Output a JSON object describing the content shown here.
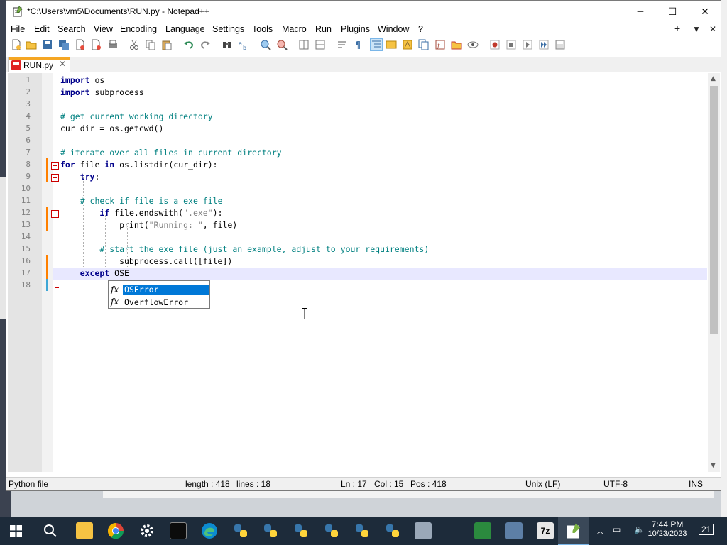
{
  "window": {
    "title": "*C:\\Users\\vm5\\Documents\\RUN.py - Notepad++",
    "minimize": "─",
    "maximize": "☐",
    "close": "✕"
  },
  "menu": {
    "items": [
      "File",
      "Edit",
      "Search",
      "View",
      "Encoding",
      "Language",
      "Settings",
      "Tools",
      "Macro",
      "Run",
      "Plugins",
      "Window",
      "?"
    ],
    "right_plus": "+",
    "right_down": "▼",
    "right_close": "✕"
  },
  "tab": {
    "label": "RUN.py",
    "close": "✕"
  },
  "editor": {
    "line_numbers": [
      "1",
      "2",
      "3",
      "4",
      "5",
      "6",
      "7",
      "8",
      "9",
      "10",
      "11",
      "12",
      "13",
      "14",
      "15",
      "16",
      "17",
      "18"
    ],
    "lines": [
      [
        {
          "t": "import",
          "c": "kw"
        },
        {
          "t": " os",
          "c": ""
        }
      ],
      [
        {
          "t": "import",
          "c": "kw"
        },
        {
          "t": " subprocess",
          "c": ""
        }
      ],
      [],
      [
        {
          "t": "# get current working directory",
          "c": "cm"
        }
      ],
      [
        {
          "t": "cur_dir = os.getcwd()",
          "c": ""
        }
      ],
      [],
      [
        {
          "t": "# iterate over all files in current directory",
          "c": "cm"
        }
      ],
      [
        {
          "t": "for",
          "c": "kw"
        },
        {
          "t": " file ",
          "c": ""
        },
        {
          "t": "in",
          "c": "kw"
        },
        {
          "t": " os.listdir(cur_dir):",
          "c": ""
        }
      ],
      [
        {
          "t": "    ",
          "c": ""
        },
        {
          "t": "try",
          "c": "kw"
        },
        {
          "t": ":",
          "c": ""
        }
      ],
      [],
      [
        {
          "t": "    ",
          "c": ""
        },
        {
          "t": "# check if file is a exe file",
          "c": "cm"
        }
      ],
      [
        {
          "t": "        ",
          "c": ""
        },
        {
          "t": "if",
          "c": "kw"
        },
        {
          "t": " file.endswith(",
          "c": ""
        },
        {
          "t": "\".exe\"",
          "c": "st"
        },
        {
          "t": "):",
          "c": ""
        }
      ],
      [
        {
          "t": "            print(",
          "c": ""
        },
        {
          "t": "\"Running: \"",
          "c": "st"
        },
        {
          "t": ", file)",
          "c": ""
        }
      ],
      [],
      [
        {
          "t": "        ",
          "c": ""
        },
        {
          "t": "# start the exe file (just an example, adjust to your requirements)",
          "c": "cm"
        }
      ],
      [
        {
          "t": "            subprocess.call([file])",
          "c": ""
        }
      ],
      [
        {
          "t": "    ",
          "c": ""
        },
        {
          "t": "except",
          "c": "kw"
        },
        {
          "t": " OSE",
          "c": ""
        }
      ],
      []
    ]
  },
  "autocomplete": {
    "icon": "fx",
    "items": [
      "OSError",
      "OverflowError"
    ],
    "selected_index": 0
  },
  "statusbar": {
    "filetype": "Python file",
    "length": "length : 418",
    "lines": "lines : 18",
    "ln": "Ln : 17",
    "col": "Col : 15",
    "pos": "Pos : 418",
    "eol": "Unix (LF)",
    "encoding": "UTF-8",
    "mode": "INS"
  },
  "taskbar": {
    "time": "7:44 PM",
    "date": "10/23/2023",
    "notifications": "21"
  }
}
